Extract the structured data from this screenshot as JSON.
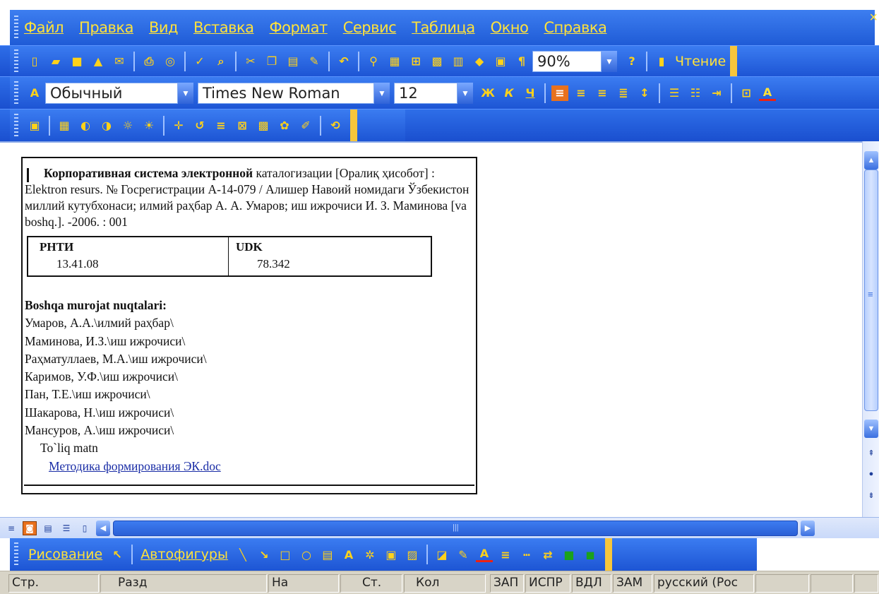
{
  "menu": {
    "items": [
      "Файл",
      "Правка",
      "Вид",
      "Вставка",
      "Формат",
      "Сервис",
      "Таблица",
      "Окно",
      "Справка"
    ],
    "close_glyph": "×"
  },
  "standard_toolbar": {
    "zoom": "90%",
    "reading_label": "Чтение"
  },
  "format_toolbar": {
    "style": "Обычный",
    "font": "Times New Roman",
    "size": "12"
  },
  "document": {
    "title_bold": "Корпоративная система электронной",
    "description_rest": "каталогизации [Оралиқ ҳисобот] : Elektron resurs. № Госрегистрации А-14-079 / Алишер Навоий номидаги Ўзбекистон миллий кутубхонаси; илмий раҳбар А. А. Умаров; иш ижрочиси И. З. Маминова [va boshq.]. -2006. : 001",
    "codes": {
      "col1_head": "РНТИ",
      "col1_value": "13.41.08",
      "col2_head": "UDK",
      "col2_value": "78.342"
    },
    "refs_heading": "Boshqa murojat nuqtalari:",
    "refs": [
      "Умаров, А.А.\\илмий раҳбар\\",
      "Маминова, И.З.\\иш ижрочиси\\",
      "Раҳматуллаев, М.А.\\иш ижрочиси\\",
      "Каримов, У.Ф.\\иш ижрочиси\\",
      "Пан, Т.Е.\\иш ижрочиси\\",
      "Шакарова, Н.\\иш ижрочиси\\",
      "Мансуров, А.\\иш ижрочиси\\"
    ],
    "full_text_label": "To`liq matn",
    "attachment_link": "Методика формирования ЭК.doc"
  },
  "drawing_toolbar": {
    "draw_label": "Рисование",
    "autoshapes_label": "Автофигуры"
  },
  "status_bar": {
    "page": "Стр.",
    "section": "Разд",
    "at": "На",
    "line": "Ст.",
    "col": "Кол",
    "rec": "ЗАП",
    "trk": "ИСПР",
    "ext": "ВДЛ",
    "ovr": "ЗАМ",
    "language": "русский (Рос"
  }
}
